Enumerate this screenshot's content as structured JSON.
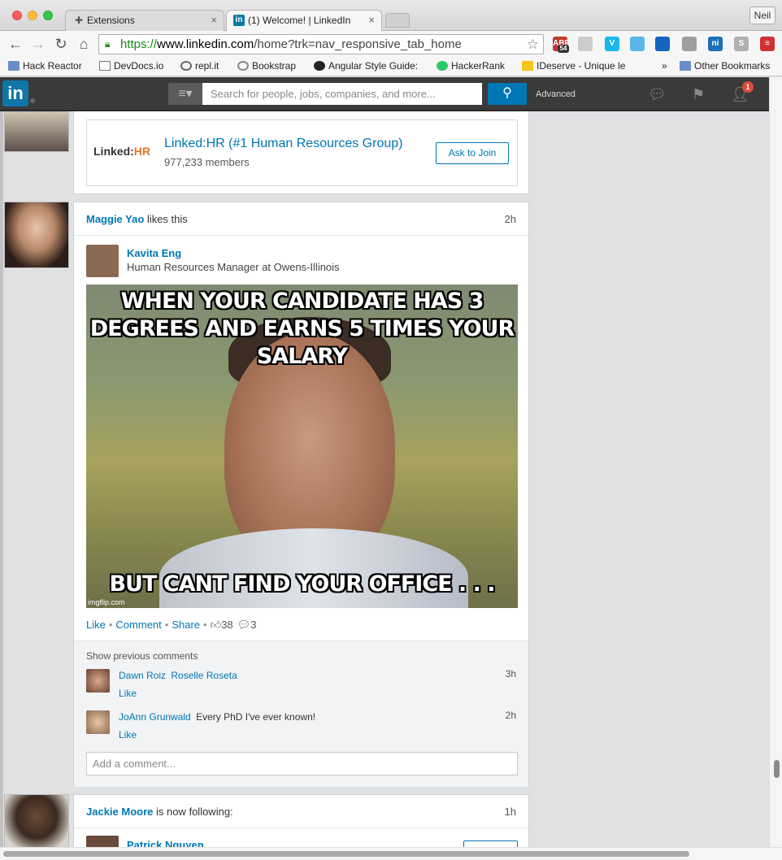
{
  "browser": {
    "tabs": [
      {
        "title": "Extensions",
        "active": false
      },
      {
        "title": "(1) Welcome! | LinkedIn",
        "active": true
      }
    ],
    "profile": "Neil",
    "url": {
      "scheme": "https://",
      "host": "www.linkedin.com",
      "path": "/home?trk=nav_responsive_tab_home"
    },
    "extensions": [
      {
        "name": "adblock-plus-icon",
        "label": "ABP",
        "count": "54",
        "color": "#c0392b"
      },
      {
        "name": "youtube-icon",
        "label": "",
        "color": "#cccccc"
      },
      {
        "name": "vimeo-icon",
        "label": "V",
        "color": "#1ab7ea"
      },
      {
        "name": "tv-icon",
        "label": "",
        "color": "#5bb5e8"
      },
      {
        "name": "react-icon",
        "label": "",
        "color": "#1565c0"
      },
      {
        "name": "grid-icon",
        "label": "",
        "color": "#9e9e9e"
      },
      {
        "name": "ni-icon",
        "label": "ni",
        "color": "#1d6fb8"
      },
      {
        "name": "s-icon",
        "label": "S",
        "color": "#b0b0b0"
      },
      {
        "name": "menu-icon",
        "label": "≡",
        "color": "#cc3333"
      }
    ],
    "bookmarks": [
      {
        "label": "Hack Reactor",
        "icon": "folder-icon"
      },
      {
        "label": "DevDocs.io",
        "icon": "devdocs-icon"
      },
      {
        "label": "repl.it",
        "icon": "replit-icon"
      },
      {
        "label": "Bookstrap",
        "icon": "bookstrap-icon"
      },
      {
        "label": "Angular Style Guide:",
        "icon": "github-icon"
      },
      {
        "label": "HackerRank",
        "icon": "hackerrank-icon"
      },
      {
        "label": "IDeserve - Unique le",
        "icon": "ideserve-icon"
      }
    ],
    "bookmarks_overflow": "»",
    "other_bookmarks": "Other Bookmarks"
  },
  "linkedin": {
    "logo": "in",
    "search_placeholder": "Search for people, jobs, companies, and more...",
    "advanced": "Advanced",
    "notification_count": "1"
  },
  "feed": {
    "group_card": {
      "logo_text": "Linked:",
      "logo_hr": "HR",
      "name": "Linked:HR (#1 Human Resources Group)",
      "members": "977,233 members",
      "join_label": "Ask to Join"
    },
    "post": {
      "actor": "Maggie Yao",
      "verb": "likes this",
      "time": "2h",
      "author_name": "Kavita Eng",
      "author_title": "Human Resources Manager at Owens-Illinois",
      "meme_top": "WHEN YOUR CANDIDATE HAS 3 DEGREES AND EARNS 5 TIMES YOUR SALARY",
      "meme_bottom": "BUT CANT FIND YOUR OFFICE . . .",
      "meme_watermark": "imgflip.com",
      "like": "Like",
      "comment": "Comment",
      "share": "Share",
      "like_count": "38",
      "comment_count": "3",
      "show_previous": "Show previous comments",
      "comments": [
        {
          "author": "Dawn Roiz",
          "text": "Roselle Roseta",
          "text_is_link": true,
          "like": "Like",
          "time": "3h"
        },
        {
          "author": "JoAnn Grunwald",
          "text": "Every PhD I've ever known!",
          "text_is_link": false,
          "like": "Like",
          "time": "2h"
        }
      ],
      "add_comment_placeholder": "Add a comment..."
    },
    "follow_post": {
      "actor": "Jackie Moore",
      "verb": "is now following:",
      "time": "1h",
      "followed_name": "Patrick Nguyen"
    }
  }
}
